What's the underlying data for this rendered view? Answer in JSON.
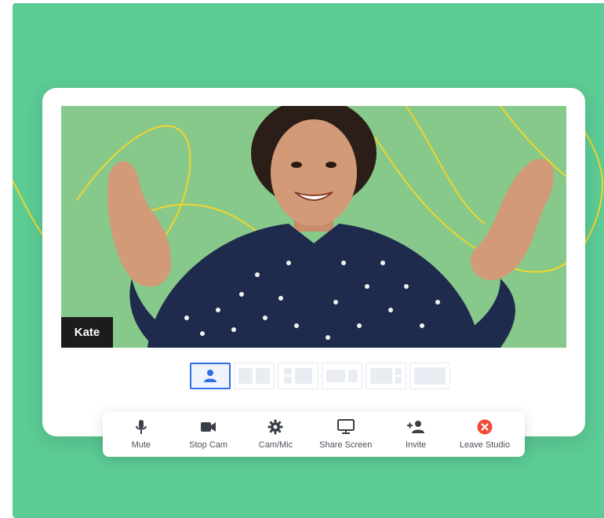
{
  "participant": {
    "name": "Kate"
  },
  "layouts": [
    {
      "id": "single"
    },
    {
      "id": "two-up"
    },
    {
      "id": "three-up"
    },
    {
      "id": "screen-plus-one"
    },
    {
      "id": "screen-side"
    },
    {
      "id": "screen-only"
    }
  ],
  "toolbar": {
    "mute_label": "Mute",
    "stop_cam_label": "Stop Cam",
    "cam_mic_label": "Cam/Mic",
    "share_screen_label": "Share Screen",
    "invite_label": "Invite",
    "leave_label": "Leave Studio"
  },
  "colors": {
    "background": "#5ccb94",
    "video_bg": "#86c98a",
    "accent": "#2f6fe0",
    "leave": "#ef4a36",
    "icon": "#3a3f47"
  }
}
